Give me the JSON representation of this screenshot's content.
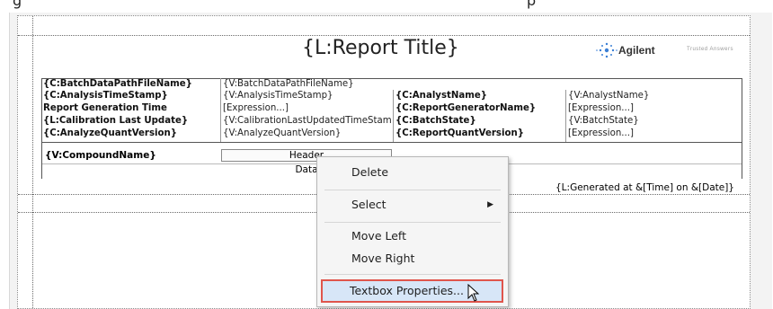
{
  "top_fragments": [
    "g",
    "p"
  ],
  "report": {
    "title": "{L:Report Title}",
    "logo_text": "Agilent",
    "logo_small": "Trusted Answers",
    "rows": [
      [
        "{C:BatchDataPathFileName}",
        "{V:BatchDataPathFileName}",
        "",
        ""
      ],
      [
        "{C:AnalysisTimeStamp}",
        "{V:AnalysisTimeStamp}",
        "{C:AnalystName}",
        "{V:AnalystName}"
      ],
      [
        "Report Generation Time",
        "[Expression...]",
        "{C:ReportGeneratorName}",
        "[Expression...]"
      ],
      [
        "{L:Calibration Last Update}",
        "{V:CalibrationLastUpdatedTimeStam",
        "{C:BatchState}",
        "{V:BatchState}"
      ],
      [
        "{C:AnalyzeQuantVersion}",
        "{V:AnalyzeQuantVersion}",
        "{C:ReportQuantVersion}",
        "[Expression...]"
      ]
    ],
    "compound": "{V:CompoundName}",
    "header_cell": "Header",
    "data_cell": "Data",
    "footer": "{L:Generated at &[Time] on &[Date]}"
  },
  "context_menu": {
    "items": [
      {
        "label": "Delete"
      },
      {
        "label": "Select",
        "submenu": true
      },
      {
        "label": "Move Left"
      },
      {
        "label": "Move Right"
      },
      {
        "label": "Textbox Properties..."
      }
    ],
    "submenu_arrow": "▶",
    "highlight_color": "#e0554c"
  }
}
